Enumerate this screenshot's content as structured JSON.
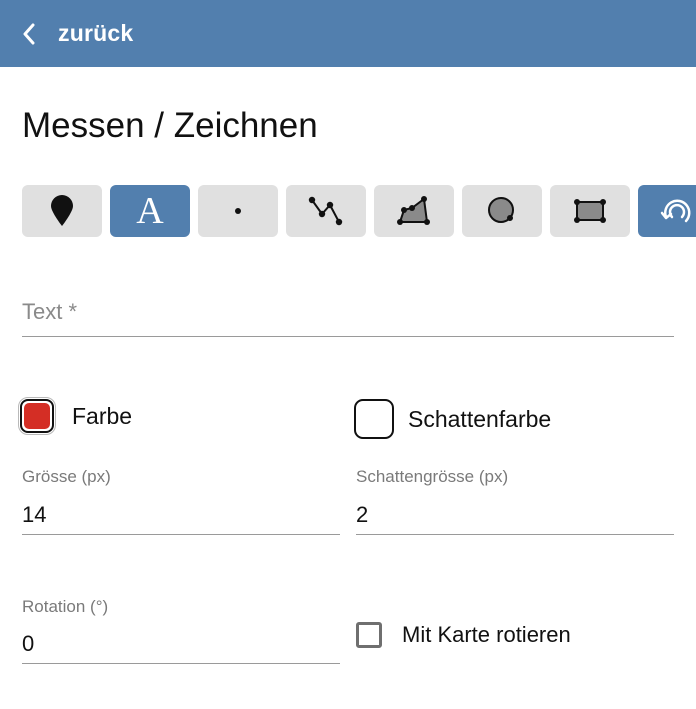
{
  "header": {
    "back_label": "zurück"
  },
  "page": {
    "title": "Messen / Zeichnen"
  },
  "toolbar": {
    "tools": [
      {
        "icon": "marker-icon",
        "active": false
      },
      {
        "icon": "text-icon",
        "glyph": "A",
        "active": true
      },
      {
        "icon": "point-icon",
        "active": false
      },
      {
        "icon": "line-icon",
        "active": false
      },
      {
        "icon": "polygon-icon",
        "active": false
      },
      {
        "icon": "circle-icon",
        "active": false
      },
      {
        "icon": "rectangle-icon",
        "active": false
      },
      {
        "icon": "rotate-icon",
        "active": true
      }
    ]
  },
  "form": {
    "text_placeholder": "Text *",
    "text_value": "",
    "color_label": "Farbe",
    "color_value": "#d42e25",
    "shadow_color_label": "Schattenfarbe",
    "shadow_color_value": "#ffffff",
    "size_label": "Grösse (px)",
    "size_value": "14",
    "shadow_size_label": "Schattengrösse (px)",
    "shadow_size_value": "2",
    "rotation_label": "Rotation (°)",
    "rotation_value": "0",
    "rotate_with_map_label": "Mit Karte rotieren",
    "rotate_with_map_checked": false
  },
  "colors": {
    "header_bg": "#527fae",
    "tool_bg": "#e0e0e0",
    "tool_active_bg": "#527fae"
  }
}
